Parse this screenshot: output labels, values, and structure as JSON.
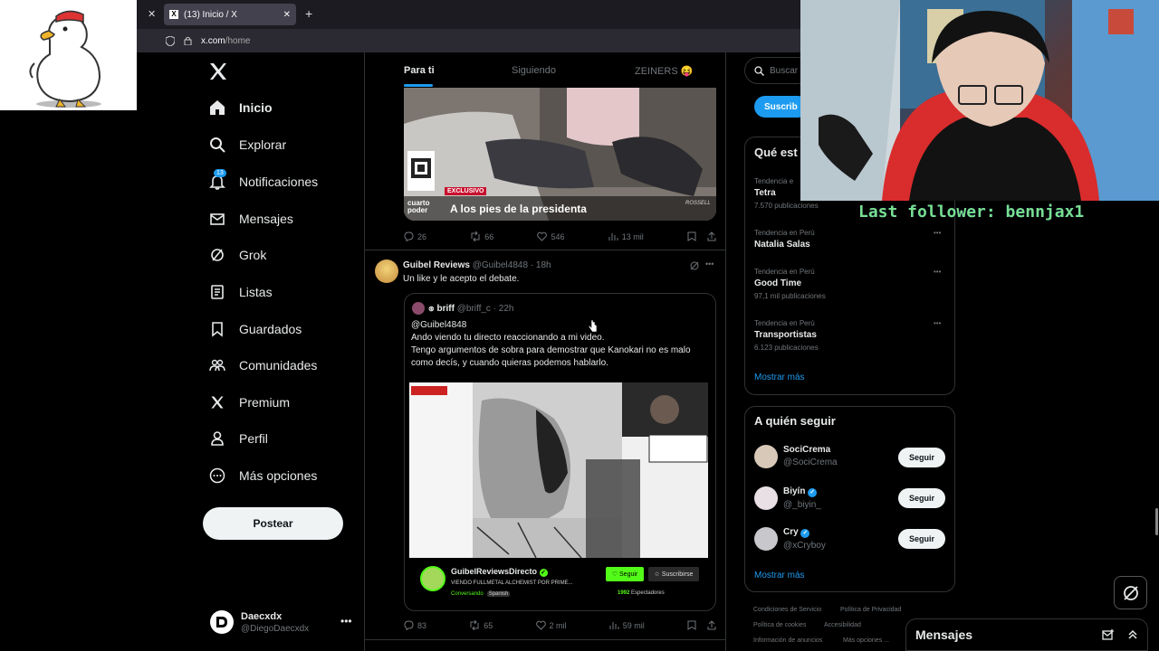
{
  "browser": {
    "tab_title": "(13) Inicio / X",
    "url_host": "x.com",
    "url_path": "/home"
  },
  "nav": {
    "items": [
      {
        "label": "Inicio",
        "icon": "home-icon"
      },
      {
        "label": "Explorar",
        "icon": "search-icon"
      },
      {
        "label": "Notificaciones",
        "icon": "bell-icon",
        "badge": "13"
      },
      {
        "label": "Mensajes",
        "icon": "mail-icon"
      },
      {
        "label": "Grok",
        "icon": "grok-icon"
      },
      {
        "label": "Listas",
        "icon": "list-icon"
      },
      {
        "label": "Guardados",
        "icon": "bookmark-icon"
      },
      {
        "label": "Comunidades",
        "icon": "communities-icon"
      },
      {
        "label": "Premium",
        "icon": "x-logo-icon"
      },
      {
        "label": "Perfil",
        "icon": "person-icon"
      },
      {
        "label": "Más opciones",
        "icon": "more-circle-icon"
      }
    ],
    "post_label": "Postear",
    "account": {
      "name": "Daecxdx",
      "handle": "@DiegoDaecxdx"
    }
  },
  "feed_tabs": [
    "Para ti",
    "Siguiendo",
    "ZEINERS 😝"
  ],
  "tweet1": {
    "image_caption_tag": "EXCLUSIVO",
    "image_caption_brand": "cuarto poder",
    "image_caption": "A los pies de la presidenta",
    "image_watermark": "ROSSELL",
    "replies": "26",
    "reposts": "66",
    "likes": "546",
    "views": "13 mil"
  },
  "tweet2": {
    "name": "Guibel Reviews",
    "handle": "@Guibel4848",
    "time": "· 18h",
    "text": "Un like y le acepto el debate.",
    "quote": {
      "name": "briff",
      "handle": "@briff_c",
      "time": "· 22h",
      "line1": "@Guibel4848",
      "line2": "Ando viendo tu directo reaccionando a mi video.",
      "line3": "Tengo argumentos de sobra para demostrar que Kanokari no es malo como decís, y cuando quieras podemos hablarlo.",
      "stream_channel": "GuibelReviewsDirecto",
      "stream_title": "VIENDO FULLMETAL ALCHEMIST POR PRIME...",
      "stream_tags": [
        "Conversando",
        "Spanish"
      ],
      "stream_follow": "Seguir",
      "stream_subscribe": "Suscribirse",
      "stream_viewers": "1992",
      "stream_viewers_label": "Espectadores"
    },
    "replies": "83",
    "reposts": "65",
    "likes": "2 mil",
    "views": "59 mil"
  },
  "right": {
    "search_placeholder": "Buscar",
    "subscribe_label": "Suscrib",
    "trends_title": "Qué est",
    "trends": [
      {
        "category": "Tendencia e",
        "name": "Tetra",
        "count": "7.570 publicaciones"
      },
      {
        "category": "Tendencia en Perú",
        "name": "Natalia Salas",
        "count": ""
      },
      {
        "category": "Tendencia en Perú",
        "name": "Good Time",
        "count": "97,1 mil publicaciones"
      },
      {
        "category": "Tendencia en Perú",
        "name": "Transportistas",
        "count": "6.123 publicaciones"
      }
    ],
    "show_more": "Mostrar más",
    "who_to_follow_title": "A quién seguir",
    "suggestions": [
      {
        "name": "SociCrema",
        "handle": "@SociCrema",
        "verified": false
      },
      {
        "name": "Biyín",
        "handle": "@_biyin_",
        "verified": true
      },
      {
        "name": "Cry",
        "handle": "@xCryboy",
        "verified": true
      }
    ],
    "follow_label": "Seguir",
    "footer": [
      "Condiciones de Servicio",
      "Política de Privacidad",
      "Política de cookies",
      "Accesibilidad",
      "Información de anuncios",
      "Más opciones ..."
    ],
    "messages_label": "Mensajes"
  },
  "overlay": {
    "follower_text": "Last follower: bennjax1"
  },
  "colors": {
    "accent": "#1d9bf0",
    "background": "#000000",
    "border": "#2f3336",
    "muted": "#71767b",
    "follower_green": "#78e08f",
    "twitch_green": "#53fc18"
  }
}
